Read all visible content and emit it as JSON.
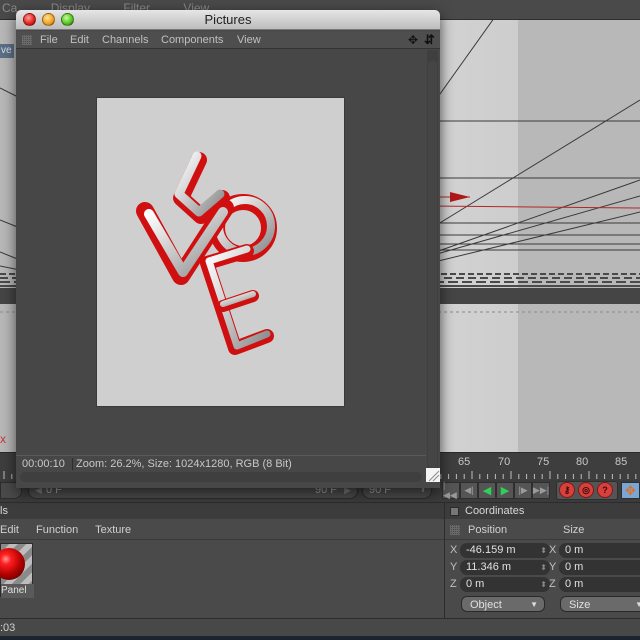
{
  "background_app": {
    "menu_partial": [
      "Ca",
      "Display",
      "Filter",
      "View"
    ],
    "viewport_label": "ve",
    "axis_marker": "x"
  },
  "pictures_window": {
    "title": "Pictures",
    "menu": [
      "File",
      "Edit",
      "Channels",
      "Components",
      "View"
    ],
    "icons": {
      "move": "move-arrows-icon",
      "vertical": "vertical-arrows-icon"
    },
    "image_subject": "LOVE 3D text render (red/silver)",
    "status_time": "00:00:10",
    "status_info": "Zoom: 26.2%, Size: 1024x1280, RGB (8 Bit)"
  },
  "timeline": {
    "tick_labels": [
      "65",
      "70",
      "75",
      "80",
      "85"
    ],
    "range_start": "0 F",
    "range_end": "90 F",
    "max_frame": "90 F",
    "transport_buttons": [
      "go-to-start",
      "previous-key",
      "play-backwards",
      "play-forwards",
      "next-key",
      "go-to-end"
    ],
    "record_buttons": [
      "record-active-objects",
      "autokeying",
      "keyframe-selection"
    ],
    "move_tool": "move-tool"
  },
  "materials": {
    "title": "ls",
    "menu": [
      "Edit",
      "Function",
      "Texture"
    ],
    "items": [
      {
        "name": "Panel",
        "color": "#e01010"
      }
    ]
  },
  "coordinates": {
    "title": "Coordinates",
    "position_header": "Position",
    "size_header": "Size",
    "rows": [
      {
        "axis": "X",
        "position": "-46.159 m",
        "size_axis": "X",
        "size": "0 m"
      },
      {
        "axis": "Y",
        "position": "11.346 m",
        "size_axis": "Y",
        "size": "0 m"
      },
      {
        "axis": "Z",
        "position": "0 m",
        "size_axis": "Z",
        "size": "0 m"
      }
    ],
    "mode_dropdown": "Object",
    "size_dropdown": "Size"
  },
  "status_bar": {
    "text": ":03"
  },
  "colors": {
    "accent_red": "#d8403c",
    "play_green": "#2fd05a",
    "move_tool_blue": "#7aa6d6"
  }
}
